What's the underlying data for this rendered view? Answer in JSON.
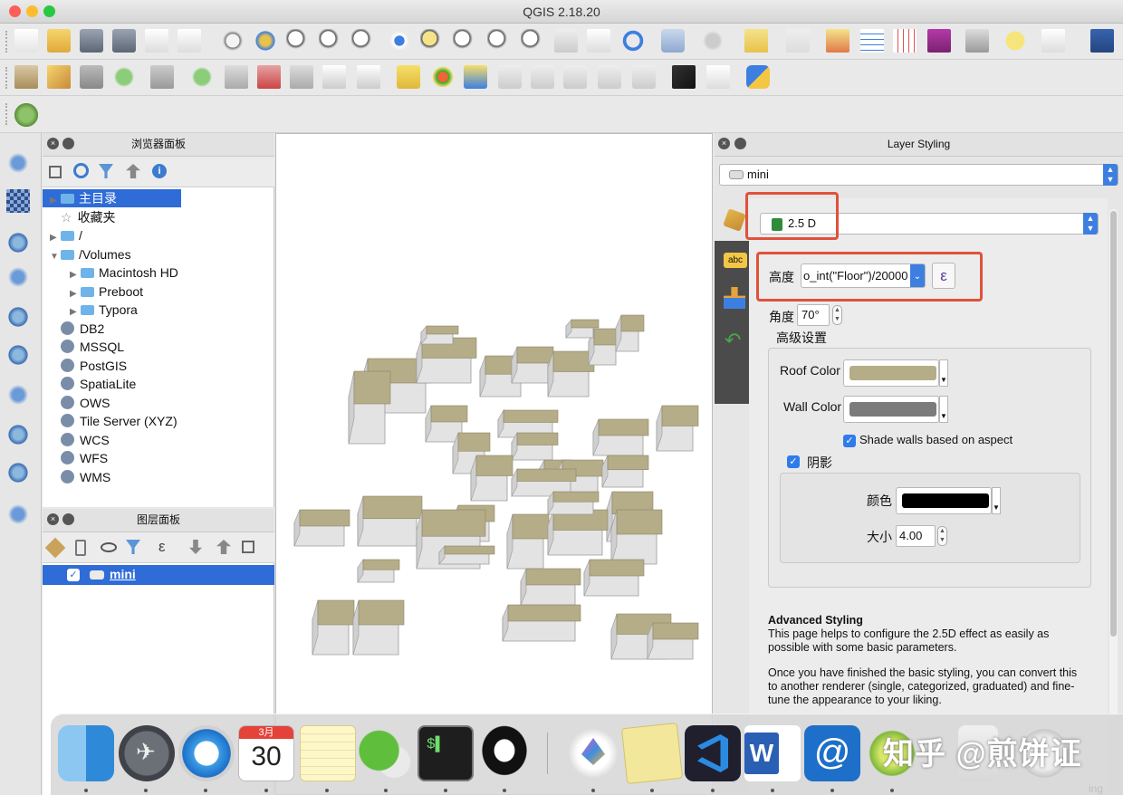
{
  "window": {
    "title": "QGIS 2.18.20"
  },
  "browser_panel": {
    "title": "浏览器面板",
    "items": [
      {
        "label": "主目录",
        "arrow": "▶",
        "selected": true
      },
      {
        "label": "收藏夹",
        "arrow": ""
      },
      {
        "label": "/",
        "arrow": "▶"
      },
      {
        "label": "/Volumes",
        "arrow": "▼"
      },
      {
        "label": "Macintosh HD",
        "arrow": "▶",
        "indent": 1
      },
      {
        "label": "Preboot",
        "arrow": "▶",
        "indent": 1
      },
      {
        "label": "Typora",
        "arrow": "▶",
        "indent": 1
      },
      {
        "label": "DB2",
        "arrow": ""
      },
      {
        "label": "MSSQL",
        "arrow": ""
      },
      {
        "label": "PostGIS",
        "arrow": ""
      },
      {
        "label": "SpatiaLite",
        "arrow": ""
      },
      {
        "label": "OWS",
        "arrow": ""
      },
      {
        "label": "Tile Server (XYZ)",
        "arrow": ""
      },
      {
        "label": "WCS",
        "arrow": ""
      },
      {
        "label": "WFS",
        "arrow": ""
      },
      {
        "label": "WMS",
        "arrow": ""
      }
    ]
  },
  "layers_panel": {
    "title": "图层面板",
    "layer": {
      "name": "mini",
      "checked": true
    }
  },
  "layer_styling": {
    "title": "Layer Styling",
    "layer_select": "mini",
    "renderer": "2.5 D",
    "height_label": "高度",
    "height_value": "o_int(\"Floor\")/20000",
    "expression_symbol": "ε",
    "angle_label": "角度",
    "angle_value": "70°",
    "advanced_label": "高级设置",
    "roof_label": "Roof Color",
    "roof_color": "#b5ac88",
    "wall_label": "Wall Color",
    "wall_color": "#7b7b7b",
    "shade_label": "Shade walls based on aspect",
    "shadow_label": "阴影",
    "shadow_color_label": "颜色",
    "shadow_color": "#000000",
    "shadow_size_label": "大小",
    "shadow_size": "4.00",
    "help_title": "Advanced Styling",
    "help_p1": "This page helps to configure the 2.5D effect as easily as possible with some basic parameters.",
    "help_p2": "Once you have finished the basic styling, you can convert this to another renderer (single, categorized, graduated) and fine-tune the appearance to your liking.",
    "help_tail": "ing"
  },
  "dock": {
    "calendar_month": "3月",
    "calendar_day": "30"
  },
  "watermark": "知乎 @煎饼证"
}
